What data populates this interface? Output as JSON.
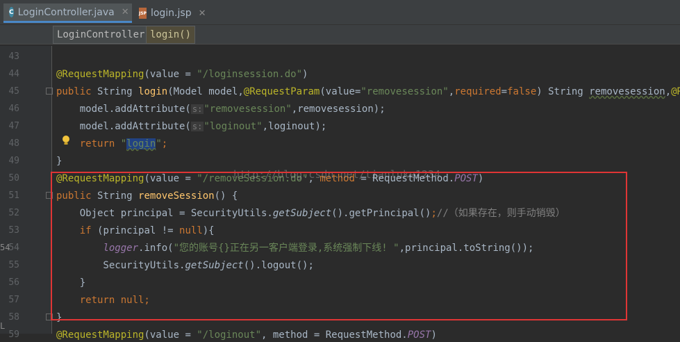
{
  "tabs": [
    {
      "label": "LoginController.java",
      "icon": "java-class-icon",
      "badge": "C"
    },
    {
      "label": "login.jsp",
      "icon": "jsp-file-icon",
      "badge": "JSP"
    }
  ],
  "breadcrumb": {
    "class": "LoginController",
    "method": "login()"
  },
  "watermark": "http://blog.csdn.net/tianluke1234",
  "side_fragments": [
    "54",
    "L"
  ],
  "lines": [
    {
      "n": "43",
      "parts": []
    },
    {
      "n": "44",
      "parts": [
        [
          "ann",
          "@RequestMapping"
        ],
        [
          "",
          "(value = "
        ],
        [
          "str",
          "\"/loginsession.do\""
        ],
        [
          "",
          ")"
        ]
      ]
    },
    {
      "n": "45",
      "parts": [
        [
          "kw",
          "public "
        ],
        [
          "",
          "String "
        ],
        [
          "fn",
          "login"
        ],
        [
          "",
          "(Model model,"
        ],
        [
          "ann",
          "@RequestParam"
        ],
        [
          "",
          "(value="
        ],
        [
          "str",
          "\"removesession\""
        ],
        [
          "",
          ","
        ],
        [
          "kw",
          "required"
        ],
        [
          "",
          "="
        ],
        [
          "kw",
          "false"
        ],
        [
          "",
          ") String "
        ],
        [
          "wavy",
          "removesession"
        ],
        [
          "",
          ","
        ],
        [
          "ann",
          "@Req"
        ]
      ]
    },
    {
      "n": "46",
      "parts": [
        [
          "",
          "    model.addAttribute("
        ],
        [
          "hint",
          "s:"
        ],
        [
          "str",
          "\"removesession\""
        ],
        [
          "",
          ",removesession);"
        ]
      ]
    },
    {
      "n": "47",
      "parts": [
        [
          "",
          "    model.addAttribute("
        ],
        [
          "hint",
          "s:"
        ],
        [
          "str",
          "\"loginout\""
        ],
        [
          "",
          ",loginout);"
        ]
      ]
    },
    {
      "n": "48",
      "parts": [
        [
          "kw",
          "    return "
        ],
        [
          "str",
          "\""
        ],
        [
          "strsel",
          "login"
        ],
        [
          "str",
          "\""
        ],
        [
          "kw",
          ";"
        ]
      ]
    },
    {
      "n": "49",
      "parts": [
        [
          "",
          "}"
        ]
      ]
    },
    {
      "n": "50",
      "parts": [
        [
          "ann",
          "@RequestMapping"
        ],
        [
          "",
          "(value = "
        ],
        [
          "str",
          "\"/removeSession.do\""
        ],
        [
          "",
          ", "
        ],
        [
          "kw",
          "method "
        ],
        [
          "",
          "= RequestMethod."
        ],
        [
          "fld",
          "POST"
        ],
        [
          "",
          ")"
        ]
      ]
    },
    {
      "n": "51",
      "parts": [
        [
          "kw",
          "public "
        ],
        [
          "",
          "String "
        ],
        [
          "fn",
          "removeSession"
        ],
        [
          "",
          "() {"
        ]
      ]
    },
    {
      "n": "52",
      "parts": [
        [
          "",
          "    Object principal = SecurityUtils."
        ],
        [
          "ital",
          "getSubject"
        ],
        [
          "",
          "().getPrincipal()"
        ],
        [
          "kw",
          ";"
        ],
        [
          "cm",
          "//（如果存在，则手动销毁）"
        ]
      ]
    },
    {
      "n": "53",
      "parts": [
        [
          "kw",
          "    if "
        ],
        [
          "",
          "(principal != "
        ],
        [
          "kw",
          "null"
        ],
        [
          "",
          "){"
        ]
      ]
    },
    {
      "n": "54",
      "parts": [
        [
          "",
          "        "
        ],
        [
          "fld",
          "logger"
        ],
        [
          "",
          ".info("
        ],
        [
          "str",
          "\"您的账号{}正在另一客户端登录,系统强制下线! \""
        ],
        [
          "",
          ",principal.toString());"
        ]
      ]
    },
    {
      "n": "55",
      "parts": [
        [
          "",
          "        SecurityUtils."
        ],
        [
          "ital",
          "getSubject"
        ],
        [
          "",
          "().logout();"
        ]
      ]
    },
    {
      "n": "56",
      "parts": [
        [
          "",
          "    }"
        ]
      ]
    },
    {
      "n": "57",
      "parts": [
        [
          "kw",
          "    return null;"
        ]
      ]
    },
    {
      "n": "58",
      "parts": [
        [
          "",
          "}"
        ]
      ]
    },
    {
      "n": "59",
      "parts": [
        [
          "ann",
          "@RequestMapping"
        ],
        [
          "",
          "(value = "
        ],
        [
          "str",
          "\"/loginout\""
        ],
        [
          "",
          ", method = RequestMethod."
        ],
        [
          "fld",
          "POST"
        ],
        [
          "",
          ")"
        ]
      ]
    }
  ],
  "colors": {
    "background": "#2b2b2b",
    "keyword": "#cc7832",
    "string": "#6a8759",
    "annotation": "#bbb529",
    "function": "#ffc66d",
    "highlight_box": "#e03535"
  }
}
